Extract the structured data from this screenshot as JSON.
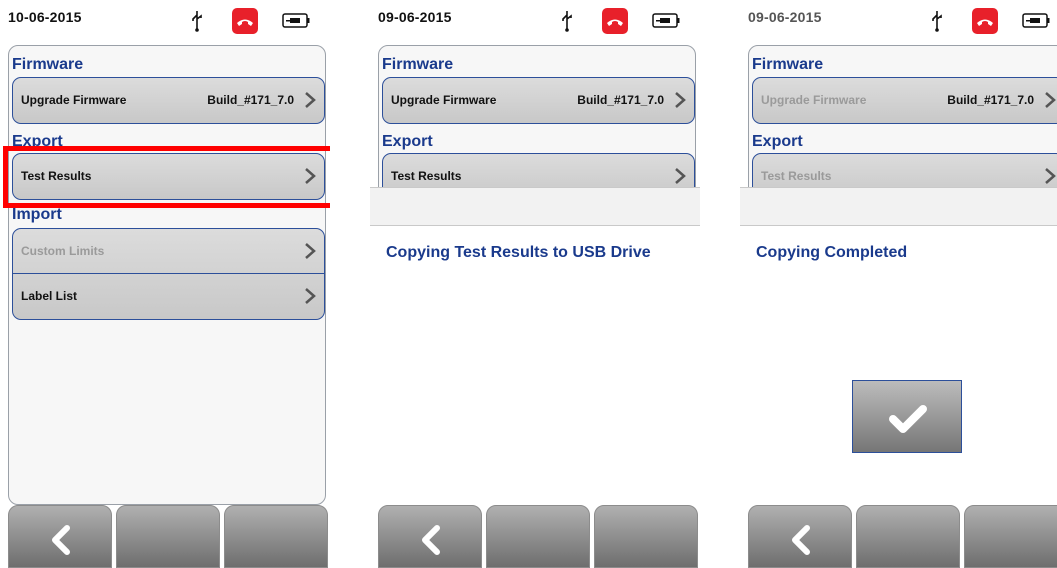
{
  "screens": [
    {
      "status": {
        "date": "10-06-2015"
      },
      "sections": {
        "firmware_title": "Firmware",
        "export_title": "Export",
        "import_title": "Import"
      },
      "rows": {
        "upgrade_label": "Upgrade Firmware",
        "upgrade_value": "Build_#171_7.0",
        "test_results_label": "Test Results",
        "custom_limits_label": "Custom Limits",
        "label_list_label": "Label List"
      }
    },
    {
      "status": {
        "date": "09-06-2015"
      },
      "sections": {
        "firmware_title": "Firmware",
        "export_title": "Export"
      },
      "rows": {
        "upgrade_label": "Upgrade Firmware",
        "upgrade_value": "Build_#171_7.0",
        "test_results_label": "Test Results"
      },
      "message": "Copying Test Results to USB Drive"
    },
    {
      "status": {
        "date": "09-06-2015"
      },
      "sections": {
        "firmware_title": "Firmware",
        "export_title": "Export"
      },
      "rows": {
        "upgrade_label": "Upgrade Firmware",
        "upgrade_value": "Build_#171_7.0",
        "test_results_label": "Test Results"
      },
      "message": "Copying Completed"
    }
  ],
  "icons": {
    "usb": "usb-icon",
    "phone": "phone-hangup-icon",
    "battery": "battery-plug-icon",
    "chevron": "chevron-right-icon",
    "back": "back-arrow-icon",
    "check": "checkmark-icon"
  },
  "colors": {
    "section_title": "#1a3a8c",
    "highlight": "#ff0000",
    "phone_icon": "#e8202a"
  }
}
